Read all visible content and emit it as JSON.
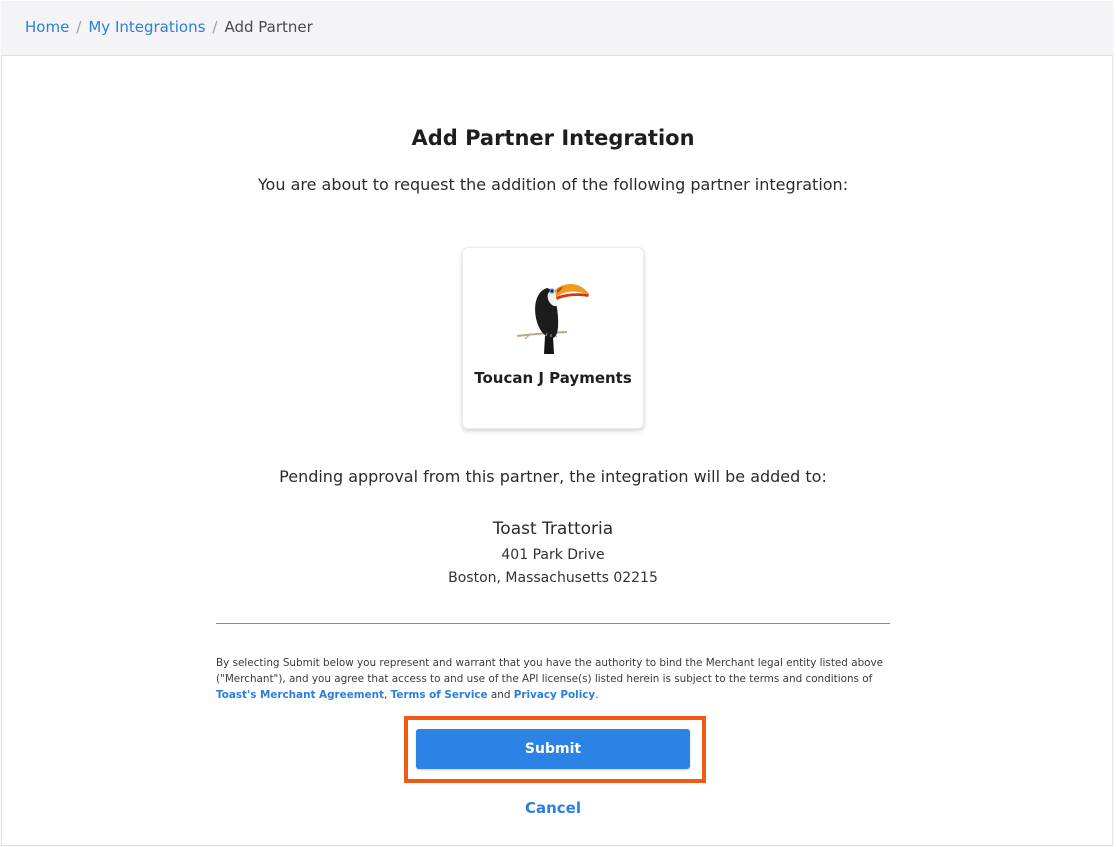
{
  "breadcrumb": {
    "items": [
      "Home",
      "My Integrations"
    ],
    "separator": "/",
    "current": "Add Partner"
  },
  "page": {
    "title": "Add Partner Integration",
    "intro": "You are about to request the addition of the following partner integration:"
  },
  "partner": {
    "name": "Toucan J Payments",
    "logo_icon": "toucan-logo"
  },
  "pending_text": "Pending approval from this partner, the integration will be added to:",
  "location": {
    "name": "Toast Trattoria",
    "address_line1": "401 Park Drive",
    "address_line2": "Boston, Massachusetts 02215"
  },
  "legal": {
    "text_before": "By selecting Submit below you represent and warrant that you have the authority to bind the Merchant legal entity listed above (\"Merchant\"), and you agree that access to and use of the API license(s) listed herein is subject to the terms and conditions of ",
    "link1": "Toast's Merchant Agreement",
    "sep1": ", ",
    "link2": "Terms of Service",
    "sep2": " and ",
    "link3": "Privacy Policy",
    "text_after": "."
  },
  "actions": {
    "submit_label": "Submit",
    "cancel_label": "Cancel"
  },
  "colors": {
    "accent": "#2c83e5",
    "link": "#2b7fdb",
    "highlight": "#f05a14"
  }
}
